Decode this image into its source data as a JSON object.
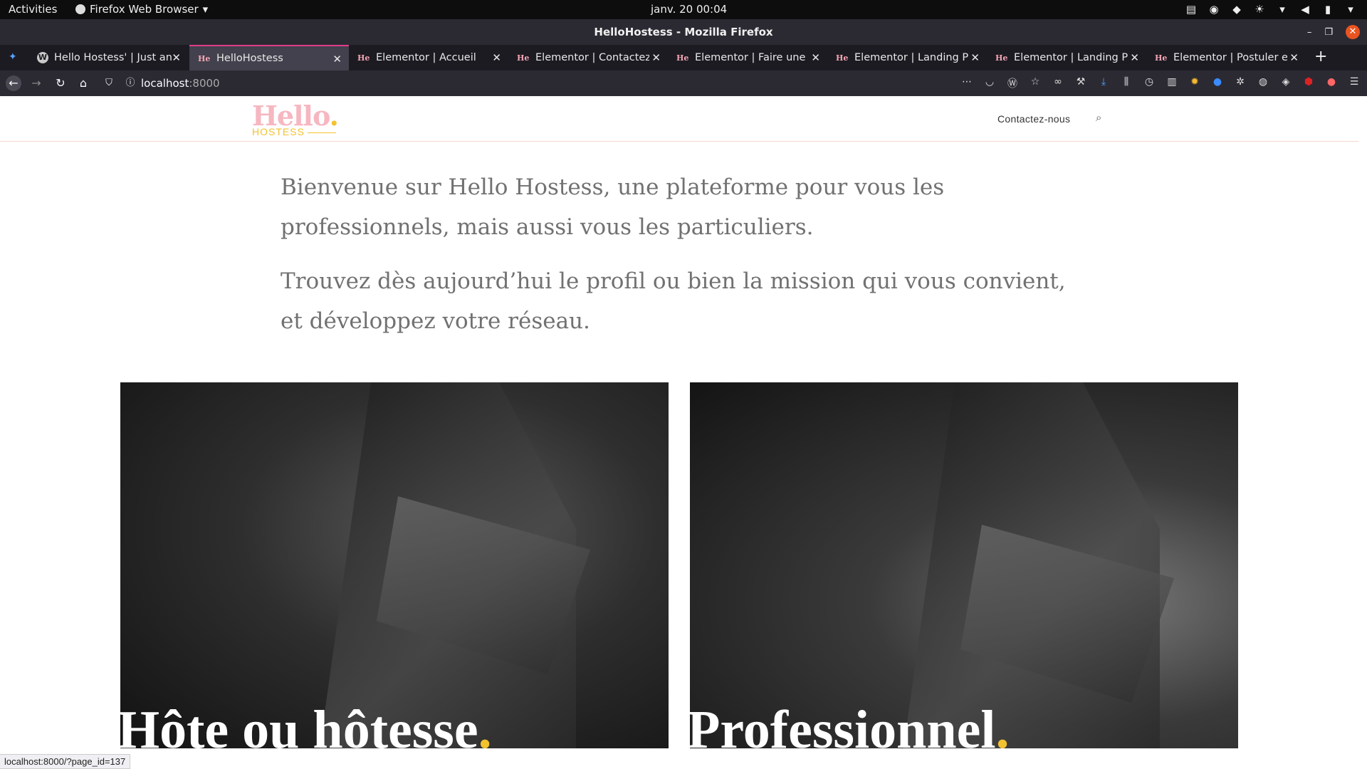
{
  "system_bar": {
    "activities": "Activities",
    "app_name": "Firefox Web Browser",
    "clock": "janv. 20  00:04"
  },
  "window": {
    "title": "HelloHostess - Mozilla Firefox"
  },
  "tabs": [
    {
      "label": "Hello Hostess' | Just another",
      "favicon": "wordpress-icon",
      "active": false
    },
    {
      "label": "HelloHostess",
      "favicon": "He",
      "active": true
    },
    {
      "label": "Elementor | Accueil",
      "favicon": "He",
      "active": false
    },
    {
      "label": "Elementor | Contactez-nous",
      "favicon": "He",
      "active": false
    },
    {
      "label": "Elementor | Faire une demande",
      "favicon": "He",
      "active": false
    },
    {
      "label": "Elementor | Landing Page",
      "favicon": "He",
      "active": false
    },
    {
      "label": "Elementor | Landing Page",
      "favicon": "He",
      "active": false
    },
    {
      "label": "Elementor | Postuler en tant",
      "favicon": "He",
      "active": false
    }
  ],
  "urlbar": {
    "host": "localhost",
    "port": ":8000"
  },
  "site": {
    "logo_main": "Hello",
    "logo_dot": ".",
    "logo_sub": "HOSTESS",
    "nav_contact": "Contactez-nous",
    "intro_p1": "Bienvenue sur Hello Hostess, une plateforme pour vous les professionnels, mais aussi vous les particuliers.",
    "intro_p2": "Trouvez dès aujourd’hui le profil ou bien la mission qui vous convient, et développez votre réseau.",
    "card1_title": "Hôte ou hôtesse",
    "card2_title": "Professionnel",
    "title_dot": ".",
    "accent_pink": "#f6b7c1",
    "accent_yellow": "#f2c230"
  },
  "status_url": "localhost:8000/?page_id=137"
}
